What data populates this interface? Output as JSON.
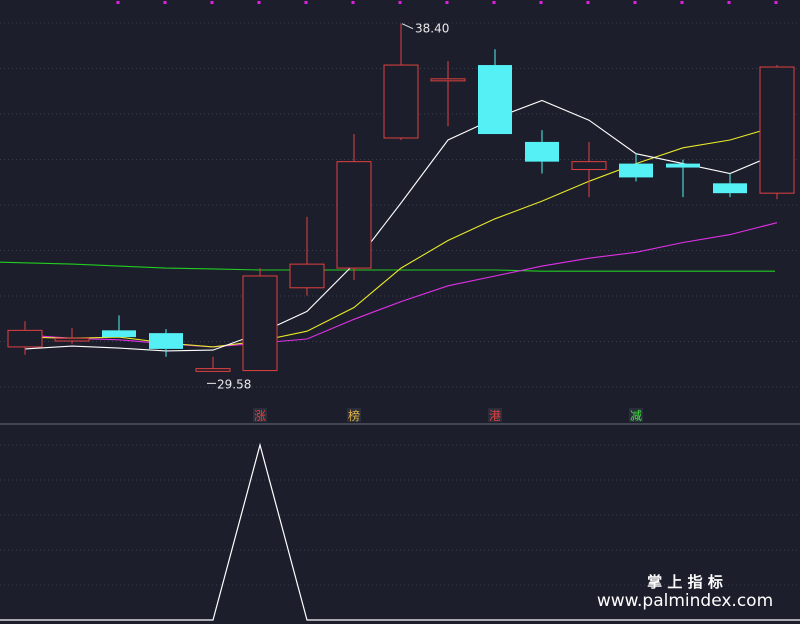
{
  "chart_data": {
    "type": "candlestick",
    "panels": [
      "price",
      "indicator"
    ],
    "colors": {
      "background": "#1c1f2b",
      "up": "#e04040",
      "down": "#55f0f5",
      "ma_white": "#ffffff",
      "ma_yellow": "#e8e82a",
      "ma_magenta": "#e030e8",
      "ma_green": "#22cc22",
      "indicator_line": "#ffffff",
      "grid": "#3a3f4e",
      "dot": "#e020e0"
    },
    "price_ylim": [
      28.6,
      39.0
    ],
    "candles": [
      {
        "o": 30.2,
        "h": 30.85,
        "l": 30.0,
        "c": 30.62
      },
      {
        "o": 30.35,
        "h": 30.68,
        "l": 30.28,
        "c": 30.42
      },
      {
        "o": 30.62,
        "h": 31.0,
        "l": 30.45,
        "c": 30.45
      },
      {
        "o": 30.55,
        "h": 30.65,
        "l": 29.95,
        "c": 30.15
      },
      {
        "o": 29.58,
        "h": 29.95,
        "l": 29.58,
        "c": 29.65
      },
      {
        "o": 29.6,
        "h": 32.2,
        "l": 29.6,
        "c": 32.0
      },
      {
        "o": 31.7,
        "h": 33.5,
        "l": 31.5,
        "c": 32.3
      },
      {
        "o": 32.2,
        "h": 35.6,
        "l": 31.9,
        "c": 34.9
      },
      {
        "o": 35.5,
        "h": 38.4,
        "l": 35.45,
        "c": 37.35
      },
      {
        "o": 36.95,
        "h": 37.45,
        "l": 35.8,
        "c": 37.0
      },
      {
        "o": 37.35,
        "h": 37.75,
        "l": 35.6,
        "c": 35.6
      },
      {
        "o": 35.4,
        "h": 35.7,
        "l": 34.6,
        "c": 34.9
      },
      {
        "o": 34.7,
        "h": 35.4,
        "l": 34.0,
        "c": 34.9
      },
      {
        "o": 34.85,
        "h": 35.1,
        "l": 34.4,
        "c": 34.5
      },
      {
        "o": 34.85,
        "h": 34.95,
        "l": 34.0,
        "c": 34.75
      },
      {
        "o": 34.35,
        "h": 34.6,
        "l": 34.0,
        "c": 34.1
      },
      {
        "o": 34.1,
        "h": 37.35,
        "l": 33.95,
        "c": 37.3
      }
    ],
    "ma_white": [
      30.15,
      30.22,
      30.17,
      30.1,
      30.12,
      30.55,
      31.1,
      32.3,
      33.85,
      35.45,
      36.0,
      36.45,
      35.95,
      35.1,
      34.85,
      34.6,
      35.1
    ],
    "ma_yellow": [
      30.45,
      30.42,
      30.45,
      30.3,
      30.2,
      30.35,
      30.6,
      31.2,
      32.2,
      32.9,
      33.45,
      33.9,
      34.4,
      34.85,
      35.25,
      35.45,
      35.8
    ],
    "ma_magenta": [
      30.5,
      30.42,
      30.38,
      30.28,
      30.2,
      30.3,
      30.4,
      30.9,
      31.35,
      31.75,
      32.0,
      32.25,
      32.45,
      32.6,
      32.85,
      33.05,
      33.35
    ],
    "ma_green_ends": [
      32.3,
      32.2
    ],
    "ma_green": [
      32.35,
      32.3,
      32.25,
      32.2,
      32.18,
      32.15,
      32.15,
      32.15,
      32.15,
      32.15,
      32.15,
      32.12,
      32.12,
      32.12,
      32.12,
      32.12,
      32.12
    ],
    "high_label": "38.40",
    "low_label": "29.58",
    "signal_labels": [
      {
        "index": 5,
        "text": "涨",
        "color": "#e04040"
      },
      {
        "index": 7,
        "text": "榜",
        "color": "#e0b040"
      },
      {
        "index": 10,
        "text": "港",
        "color": "#e04040"
      },
      {
        "index": 13,
        "text": "减",
        "color": "#40e040"
      }
    ],
    "indicator": [
      0,
      0,
      0,
      0,
      0,
      1,
      0,
      0,
      0,
      0,
      0,
      0,
      0,
      0,
      0,
      0,
      0
    ],
    "indicator_ylim": [
      0,
      1
    ]
  },
  "watermark": {
    "title": "掌 上 指 标",
    "url": "www.palmindex.com"
  }
}
